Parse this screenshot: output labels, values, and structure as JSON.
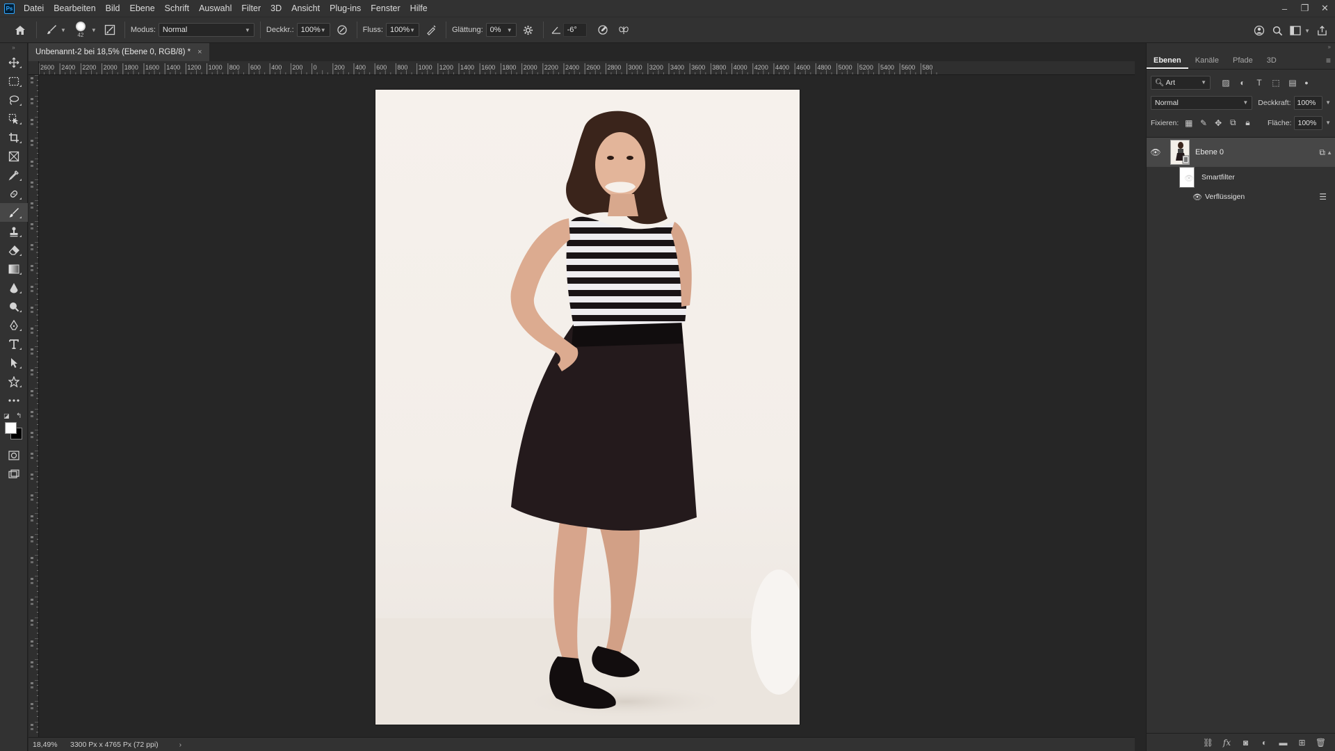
{
  "app": {
    "logo": "Ps",
    "menu": [
      "Datei",
      "Bearbeiten",
      "Bild",
      "Ebene",
      "Schrift",
      "Auswahl",
      "Filter",
      "3D",
      "Ansicht",
      "Plug-ins",
      "Fenster",
      "Hilfe"
    ],
    "window_controls": {
      "minimize": "–",
      "restore": "❐",
      "close": "✕"
    }
  },
  "options": {
    "brush_size": "42",
    "modus_label": "Modus:",
    "modus_value": "Normal",
    "deckkraft_label": "Deckkr.:",
    "deckkraft_value": "100%",
    "fluss_label": "Fluss:",
    "fluss_value": "100%",
    "glaettung_label": "Glättung:",
    "glaettung_value": "0%",
    "angle_value": "-6°"
  },
  "document": {
    "tab_title": "Unbenannt-2 bei 18,5% (Ebene 0, RGB/8) *",
    "close_glyph": "×",
    "ruler_top_labels": [
      "2600",
      "2400",
      "2200",
      "2000",
      "1800",
      "1600",
      "1400",
      "1200",
      "1000",
      "800",
      "600",
      "400",
      "200",
      "0",
      "200",
      "400",
      "600",
      "800",
      "1000",
      "1200",
      "1400",
      "1600",
      "1800",
      "2000",
      "2200",
      "2400",
      "2600",
      "2800",
      "3000",
      "3200",
      "3400",
      "3600",
      "3800",
      "4000",
      "4200",
      "4400",
      "4600",
      "4800",
      "5000",
      "5200",
      "5400",
      "5600",
      "580"
    ]
  },
  "status": {
    "zoom": "18,49%",
    "doc_size": "3300 Px x 4765 Px (72 ppi)",
    "arrow": "›"
  },
  "panels": {
    "tabs": [
      "Ebenen",
      "Kanäle",
      "Pfade",
      "3D"
    ],
    "active_tab": "Ebenen",
    "filter_kind": "Art",
    "blend_mode": "Normal",
    "opacity_label": "Deckkraft:",
    "opacity_value": "100%",
    "lock_label": "Fixieren:",
    "fill_label": "Fläche:",
    "fill_value": "100%",
    "layers": [
      {
        "name": "Ebene 0",
        "visible": true,
        "selected": true,
        "smart_object": true
      }
    ],
    "smart_filter_label": "Smartfilter",
    "filters": [
      "Verflüssigen"
    ]
  },
  "colors": {
    "accent": "#31a8ff",
    "foreground_swatch": "#ffffff",
    "background_swatch": "#000000"
  }
}
